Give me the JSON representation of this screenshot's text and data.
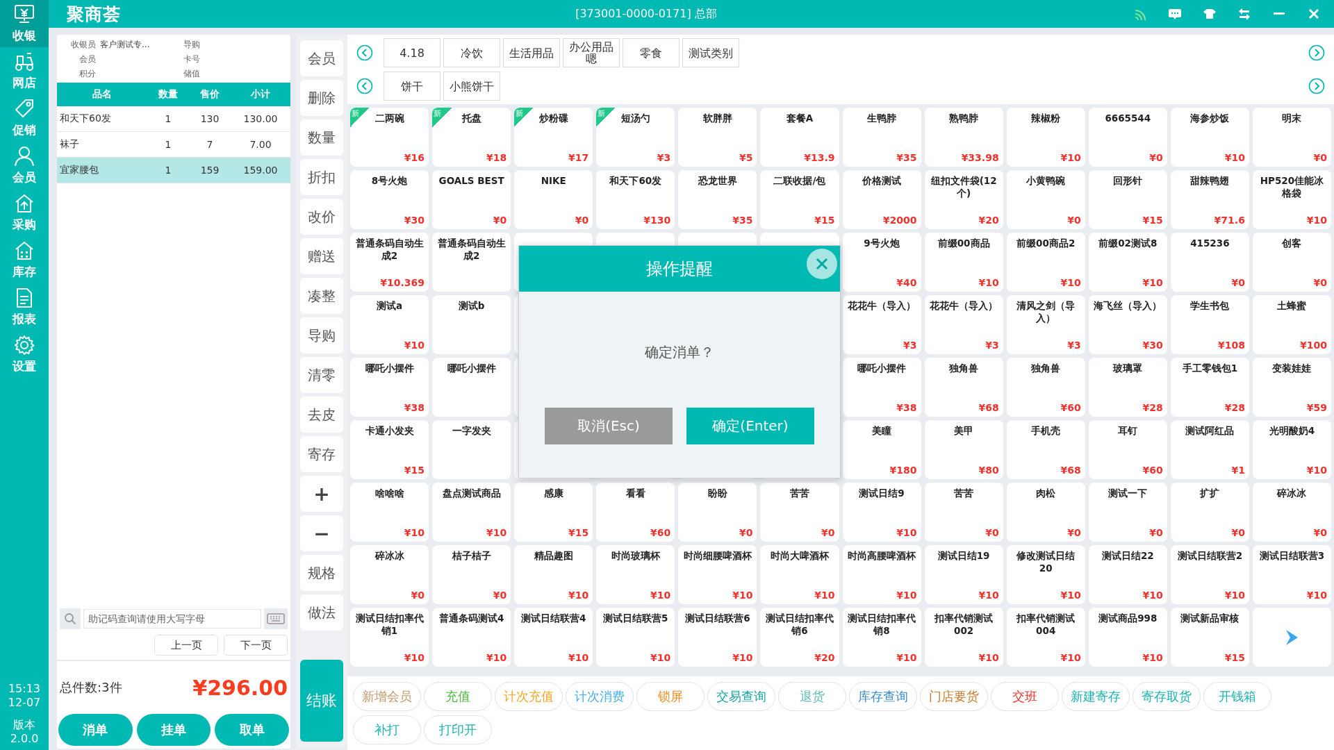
{
  "sidebar": {
    "items": [
      {
        "label": "收银",
        "selected": true
      },
      {
        "label": "网店",
        "selected": false
      },
      {
        "label": "促销",
        "selected": false
      },
      {
        "label": "会员",
        "selected": false
      },
      {
        "label": "采购",
        "selected": false
      },
      {
        "label": "库存",
        "selected": false
      },
      {
        "label": "报表",
        "selected": false
      },
      {
        "label": "设置",
        "selected": false
      }
    ],
    "time": "15:13",
    "date": "12-07",
    "version_label": "版本",
    "version": "2.0.0"
  },
  "titlebar": {
    "logo": "聚商荟",
    "title": "[373001-0000-0171] 总部"
  },
  "order": {
    "info": [
      {
        "label": "收银员",
        "value": "客户测试专..."
      },
      {
        "label": "导购"
      },
      {
        "label": "会员"
      },
      {
        "label": "卡号"
      },
      {
        "label": "积分"
      },
      {
        "label": "储值"
      }
    ],
    "columns": [
      "品名",
      "数量",
      "售价",
      "小计"
    ],
    "rows": [
      {
        "name": "和天下60发",
        "qty": "1",
        "price": "130",
        "subtotal": "130.00",
        "selected": false
      },
      {
        "name": "袜子",
        "qty": "1",
        "price": "7",
        "subtotal": "7.00",
        "selected": false
      },
      {
        "name": "宜家腰包",
        "qty": "1",
        "price": "159",
        "subtotal": "159.00",
        "selected": true
      }
    ],
    "search": {
      "placeholder": "助记码查询请使用大写字母"
    },
    "prev_page": "上一页",
    "next_page": "下一页",
    "total_count": "总件数:3件",
    "total_amount": "¥296.00",
    "buttons": [
      "消单",
      "挂单",
      "取单"
    ]
  },
  "actions": [
    "会员",
    "删除",
    "数量",
    "折扣",
    "改价",
    "赠送",
    "凑整",
    "导购",
    "清零",
    "去皮",
    "寄存",
    "+",
    "−",
    "规格",
    "做法"
  ],
  "checkout": "结账",
  "categories": {
    "rows": [
      [
        "4.18",
        "冷饮",
        "生活用品",
        "办公用品嗯",
        "零食",
        "测试类别"
      ],
      [
        "饼干",
        "小熊饼干"
      ]
    ]
  },
  "products": {
    "rows": [
      [
        {
          "name": "二两碗",
          "price": "¥16",
          "badge": "新"
        },
        {
          "name": "托盘",
          "price": "¥18",
          "badge": "新"
        },
        {
          "name": "炒粉碟",
          "price": "¥17",
          "badge": "新"
        },
        {
          "name": "短汤勺",
          "price": "¥3",
          "badge": "新"
        },
        {
          "name": "软胖胖",
          "price": "¥5"
        },
        {
          "name": "套餐A",
          "price": "¥13.9"
        },
        {
          "name": "生鸭脖",
          "price": "¥35"
        },
        {
          "name": "熟鸭脖",
          "price": "¥33.98"
        },
        {
          "name": "辣椒粉",
          "price": "¥10"
        },
        {
          "name": "6665544",
          "price": "¥0"
        },
        {
          "name": "海参炒饭",
          "price": "¥10"
        },
        {
          "name": "明末",
          "price": "¥0"
        }
      ],
      [
        {
          "name": "8号火炮",
          "price": "¥30"
        },
        {
          "name": "GOALS BEST",
          "price": "¥0"
        },
        {
          "name": "NIKE",
          "price": "¥0"
        },
        {
          "name": "和天下60发",
          "price": "¥130"
        },
        {
          "name": "恐龙世界",
          "price": "¥35"
        },
        {
          "name": "二联收据/包",
          "price": "¥15"
        },
        {
          "name": "价格测试",
          "price": "¥2000"
        },
        {
          "name": "纽扣文件袋(12个)",
          "price": "¥20"
        },
        {
          "name": "小黄鸭碗",
          "price": "¥0"
        },
        {
          "name": "回形针",
          "price": "¥15"
        },
        {
          "name": "甜辣鸭翅",
          "price": "¥71.6"
        },
        {
          "name": "HP520佳能冰格袋",
          "price": "¥10"
        }
      ],
      [
        {
          "name": "普通条码自动生成2",
          "price": "¥10.369"
        },
        {
          "name": "普通条码自动生成2"
        },
        {},
        {},
        {},
        {},
        {
          "name": "9号火炮",
          "price": "¥40"
        },
        {
          "name": "前缀00商品",
          "price": "¥10"
        },
        {
          "name": "前缀00商品2",
          "price": "¥10"
        },
        {
          "name": "前缀02测试8",
          "price": "¥10"
        },
        {
          "name": "415236",
          "price": "¥0"
        },
        {
          "name": "创客",
          "price": "¥0"
        }
      ],
      [
        {
          "name": "测试a",
          "price": "¥10"
        },
        {
          "name": "测试b"
        },
        {},
        {},
        {},
        {},
        {
          "name": "花花牛（导入）",
          "price": "¥3"
        },
        {
          "name": "花花牛（导入）",
          "price": "¥3"
        },
        {
          "name": "清风之剑（导入）",
          "price": "¥3"
        },
        {
          "name": "海飞丝（导入）",
          "price": "¥30"
        },
        {
          "name": "学生书包",
          "price": "¥108"
        },
        {
          "name": "土蜂蜜",
          "price": "¥100"
        }
      ],
      [
        {
          "name": "哪吒小摆件",
          "price": "¥38"
        },
        {
          "name": "哪吒小摆件"
        },
        {},
        {},
        {},
        {},
        {
          "name": "哪吒小摆件",
          "price": "¥38"
        },
        {
          "name": "独角兽",
          "price": "¥68"
        },
        {
          "name": "独角兽",
          "price": "¥60"
        },
        {
          "name": "玻璃罩",
          "price": "¥28"
        },
        {
          "name": "手工零钱包1",
          "price": "¥28"
        },
        {
          "name": "变装娃娃",
          "price": "¥59"
        }
      ],
      [
        {
          "name": "卡通小发夹",
          "price": "¥15"
        },
        {
          "name": "一字发夹"
        },
        {},
        {},
        {},
        {},
        {
          "name": "美瞳",
          "price": "¥180"
        },
        {
          "name": "美甲",
          "price": "¥80"
        },
        {
          "name": "手机壳",
          "price": "¥68"
        },
        {
          "name": "耳钉",
          "price": "¥60"
        },
        {
          "name": "测试阿红品",
          "price": "¥1"
        },
        {
          "name": "光明酸奶4",
          "price": "¥10"
        }
      ],
      [
        {
          "name": "啥啥啥",
          "price": "¥10"
        },
        {
          "name": "盘点测试商品",
          "price": "¥10"
        },
        {
          "name": "感康",
          "price": "¥15"
        },
        {
          "name": "看看",
          "price": "¥60"
        },
        {
          "name": "盼盼",
          "price": "¥0"
        },
        {
          "name": "苦苦",
          "price": "¥0"
        },
        {
          "name": "测试日结9",
          "price": "¥10"
        },
        {
          "name": "苦苦",
          "price": "¥0"
        },
        {
          "name": "肉松",
          "price": "¥0"
        },
        {
          "name": "测试一下",
          "price": "¥0"
        },
        {
          "name": "扩扩",
          "price": "¥0"
        },
        {
          "name": "碎冰冰",
          "price": "¥0"
        }
      ],
      [
        {
          "name": "碎冰冰",
          "price": "¥0"
        },
        {
          "name": "桔子桔子",
          "price": "¥0"
        },
        {
          "name": "精品趣图",
          "price": "¥10"
        },
        {
          "name": "时尚玻璃杯",
          "price": "¥10"
        },
        {
          "name": "时尚细腰啤酒杯",
          "price": "¥10"
        },
        {
          "name": "时尚大啤酒杯",
          "price": "¥10"
        },
        {
          "name": "时尚高腰啤酒杯",
          "price": "¥10"
        },
        {
          "name": "测试日结19",
          "price": "¥10"
        },
        {
          "name": "修改测试日结20",
          "price": "¥10"
        },
        {
          "name": "测试日结22",
          "price": "¥10"
        },
        {
          "name": "测试日结联营2",
          "price": "¥10"
        },
        {
          "name": "测试日结联营3",
          "price": "¥10"
        }
      ],
      [
        {
          "name": "测试日结扣率代销1",
          "price": "¥10"
        },
        {
          "name": "普通条码测试4",
          "price": "¥10"
        },
        {
          "name": "测试日结联营4",
          "price": "¥10"
        },
        {
          "name": "测试日结联营5",
          "price": "¥10"
        },
        {
          "name": "测试日结联营6",
          "price": "¥10"
        },
        {
          "name": "测试日结扣率代销6",
          "price": "¥20"
        },
        {
          "name": "测试日结扣率代销8",
          "price": "¥10"
        },
        {
          "name": "扣率代销测试002",
          "price": "¥10"
        },
        {
          "name": "扣率代销测试004",
          "price": "¥10"
        },
        {
          "name": "测试商品998",
          "price": "¥10"
        },
        {
          "name": "测试新品审核",
          "price": "¥15"
        }
      ]
    ]
  },
  "functions": [
    {
      "label": "新增会员",
      "color": "#c09a6b"
    },
    {
      "label": "充值",
      "color": "#4cbb3c"
    },
    {
      "label": "计次充值",
      "color": "#f5a623"
    },
    {
      "label": "计次消费",
      "color": "#3fb1e8"
    },
    {
      "label": "锁屏",
      "color": "#f08c1e"
    },
    {
      "label": "交易查询",
      "color": "#14a8a0"
    },
    {
      "label": "退货",
      "color": "#5fb8b4"
    },
    {
      "label": "库存查询",
      "color": "#3a8bd0"
    },
    {
      "label": "门店要货",
      "color": "#c87a2a"
    },
    {
      "label": "交班",
      "color": "#f0302a"
    },
    {
      "label": "新建寄存",
      "color": "#19b2b0"
    },
    {
      "label": "寄存取货",
      "color": "#19b2b0"
    },
    {
      "label": "开钱箱",
      "color": "#19b2b0"
    },
    {
      "label": "补打",
      "color": "#19b2b0"
    },
    {
      "label": "打印开",
      "color": "#19b2b0"
    }
  ],
  "dialog": {
    "title": "操作提醒",
    "message": "确定消单？",
    "cancel": "取消(Esc)",
    "confirm": "确定(Enter)"
  }
}
